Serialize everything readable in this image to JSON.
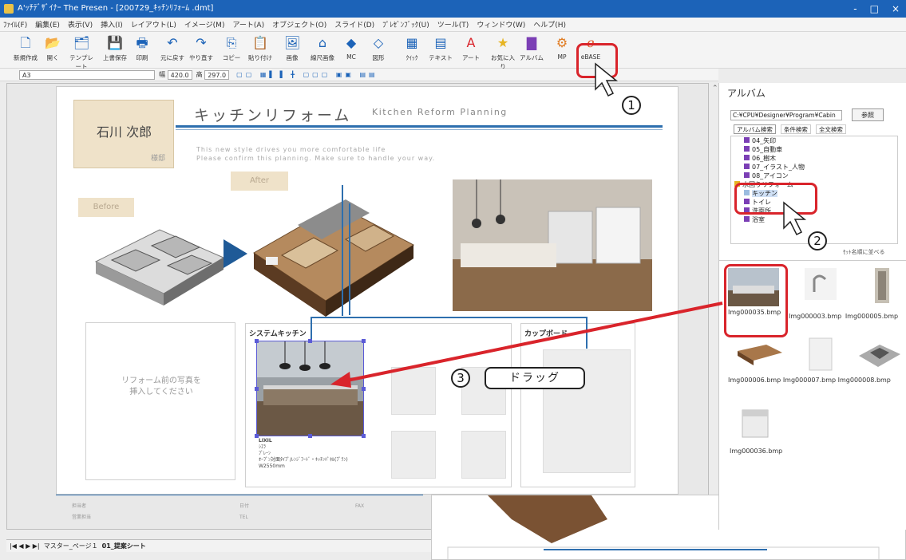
{
  "window": {
    "title": "A'ｯﾁﾃﾞｻﾞｲﾅｰ The Presen - [200729_ｷｯﾁﾝﾘﾌｫｰﾑ .dmt]",
    "min": "-",
    "max": "□",
    "close": "×"
  },
  "menu": [
    "ﾌｧｲﾙ(F)",
    "編集(E)",
    "表示(V)",
    "挿入(I)",
    "レイアウト(L)",
    "イメージ(M)",
    "アート(A)",
    "オブジェクト(O)",
    "スライド(D)",
    "ﾌﾟﾚｾﾞﾝﾌﾞｯｸ(U)",
    "ツール(T)",
    "ウィンドウ(W)",
    "ヘルプ(H)"
  ],
  "toolbar": {
    "items": [
      {
        "label": "新規作成",
        "icon": "new-file-icon",
        "glyph": "🗋"
      },
      {
        "label": "開く",
        "icon": "open-folder-icon",
        "glyph": "📂"
      },
      {
        "label": "テンプレート",
        "icon": "template-icon",
        "glyph": "🗂"
      },
      {
        "label": "上書保存",
        "icon": "save-icon",
        "glyph": "💾"
      },
      {
        "label": "印刷",
        "icon": "print-icon",
        "glyph": "🖶"
      },
      {
        "label": "元に戻す",
        "icon": "undo-icon",
        "glyph": "↶"
      },
      {
        "label": "やり直す",
        "icon": "redo-icon",
        "glyph": "↷"
      },
      {
        "label": "コピー",
        "icon": "copy-icon",
        "glyph": "⎘"
      },
      {
        "label": "貼り付け",
        "icon": "paste-icon",
        "glyph": "📋"
      },
      {
        "label": "画像",
        "icon": "image-icon",
        "glyph": "🖼"
      },
      {
        "label": "線尺画像",
        "icon": "house-image-icon",
        "glyph": "⌂"
      },
      {
        "label": "MC",
        "icon": "mc-icon",
        "glyph": "◆"
      },
      {
        "label": "図形",
        "icon": "shape-icon",
        "glyph": "◇"
      },
      {
        "label": "ｸｲｯｸ",
        "icon": "quick-icon",
        "glyph": "▦"
      },
      {
        "label": "テキスト",
        "icon": "text-icon",
        "glyph": "▤"
      },
      {
        "label": "アート",
        "icon": "art-icon",
        "glyph": "A"
      },
      {
        "label": "お気に入り",
        "icon": "star-icon",
        "glyph": "★"
      },
      {
        "label": "アルバム",
        "icon": "album-icon",
        "glyph": "▇"
      },
      {
        "label": "MP",
        "icon": "mp-icon",
        "glyph": "⚙"
      },
      {
        "label": "eBASE",
        "icon": "ebase-icon",
        "glyph": "ℯ"
      }
    ]
  },
  "drawbar": {
    "paper": "A3",
    "width_label": "幅",
    "width": "420.0",
    "height_label": "高",
    "height": "297.0"
  },
  "slide": {
    "title": "キッチンリフォーム",
    "subtitle": "Kitchen Reform Planning",
    "client_name": "石川 次郎",
    "honorific": "様邸",
    "desc1": "This new style drives you more comfortable life",
    "desc2": "Please confirm this planning. Make sure to handle your way.",
    "after_label": "After",
    "before_label": "Before",
    "placeholder_text1": "リフォーム前の写真を",
    "placeholder_text2": "挿入してください",
    "system_kitchen_label": "システムキッチン",
    "cupboard_label": "カップボード",
    "spec_title": "LIXIL",
    "spec_lines": [
      "ｼｴﾗ",
      "ﾌﾟﾚｰﾝ",
      "ｵｰﾌﾟﾝ対面ﾀｲﾌﾟ/ﾚﾝｼﾞﾌｰﾄﾞ・ｷｯﾁﾝﾊﾟﾈﾙ(ﾌﾟﾗﾝ)",
      "W2550mm"
    ],
    "footer_left": [
      "担当者",
      "営業担当"
    ],
    "footer_mid": [
      "日付",
      "TEL"
    ],
    "footer_right": [
      "",
      "FAX"
    ]
  },
  "album": {
    "header": "アルバム",
    "path": "C:¥CPU¥Designer¥Program¥Cabin",
    "browse_button": "参照",
    "tabs": [
      "アルバム検索",
      "条件検索",
      "全文検索"
    ],
    "tree": [
      "04_矢印",
      "05_自動車",
      "06_樹木",
      "07_イラスト_人物",
      "08_アイコン",
      "水回りリフォーム",
      "キッチン",
      "トイレ",
      "洗面所",
      "浴室"
    ],
    "add_link": "ｾｯﾄ名順に並べる",
    "thumbnails": [
      "Img000035.bmp",
      "Img000003.bmp",
      "Img000005.bmp",
      "Img000006.bmp",
      "Img000007.bmp",
      "Img000008.bmp",
      "Img000036.bmp"
    ]
  },
  "annotations": {
    "step1": "1",
    "step2": "2",
    "step3": "3",
    "drag_label": "ドラッグ"
  },
  "sheet_tabs": {
    "nav": "|◀ ◀ ▶ ▶|",
    "tab1": "マスター_ページ１",
    "tab2": "01_提案シート"
  },
  "colors": {
    "accent_red": "#d9242b",
    "title_blue": "#1c63b8",
    "line_blue": "#2e6fae",
    "beige": "#efe2c9"
  }
}
